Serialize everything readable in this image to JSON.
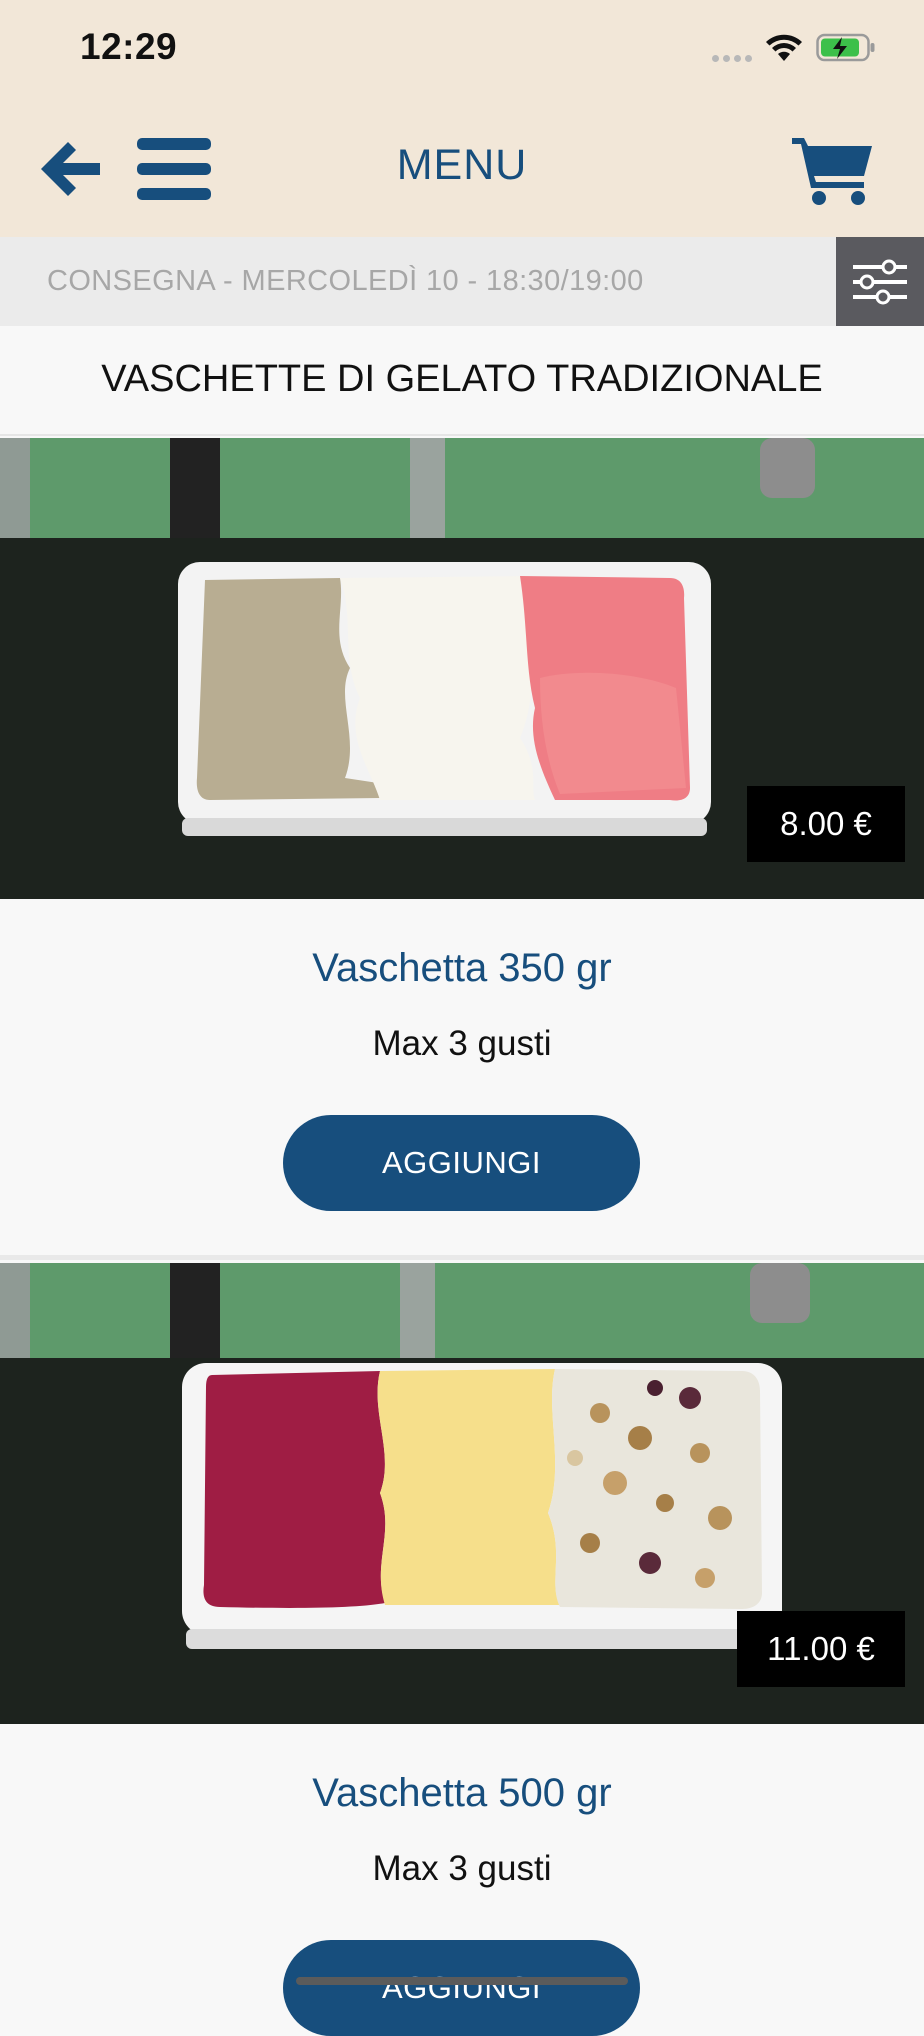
{
  "status_bar": {
    "time": "12:29",
    "icons": [
      "cellular-signal-icon",
      "wifi-icon",
      "battery-charging-icon"
    ]
  },
  "header": {
    "title": "MENU",
    "back_icon": "arrow-left-icon",
    "menu_icon": "hamburger-icon",
    "cart_icon": "shopping-cart-icon"
  },
  "delivery": {
    "text": "CONSEGNA - MERCOLEDÌ 10 - 18:30/19:00",
    "filter_icon": "sliders-icon"
  },
  "category": {
    "title": "VASCHETTE DI GELATO TRADIZIONALE"
  },
  "products": [
    {
      "name": "Vaschetta 350 gr",
      "description": "Max 3 gusti",
      "price": "8.00 €",
      "button_label": "AGGIUNGI"
    },
    {
      "name": "Vaschetta 500 gr",
      "description": "Max 3 gusti",
      "price": "11.00 €",
      "button_label": "AGGIUNGI"
    }
  ],
  "colors": {
    "header_bg": "#f2e7d8",
    "brand_blue": "#174e7d",
    "delivery_bg": "#ebebeb",
    "filter_bg": "#5a5a5f",
    "price_bg": "#000000"
  }
}
